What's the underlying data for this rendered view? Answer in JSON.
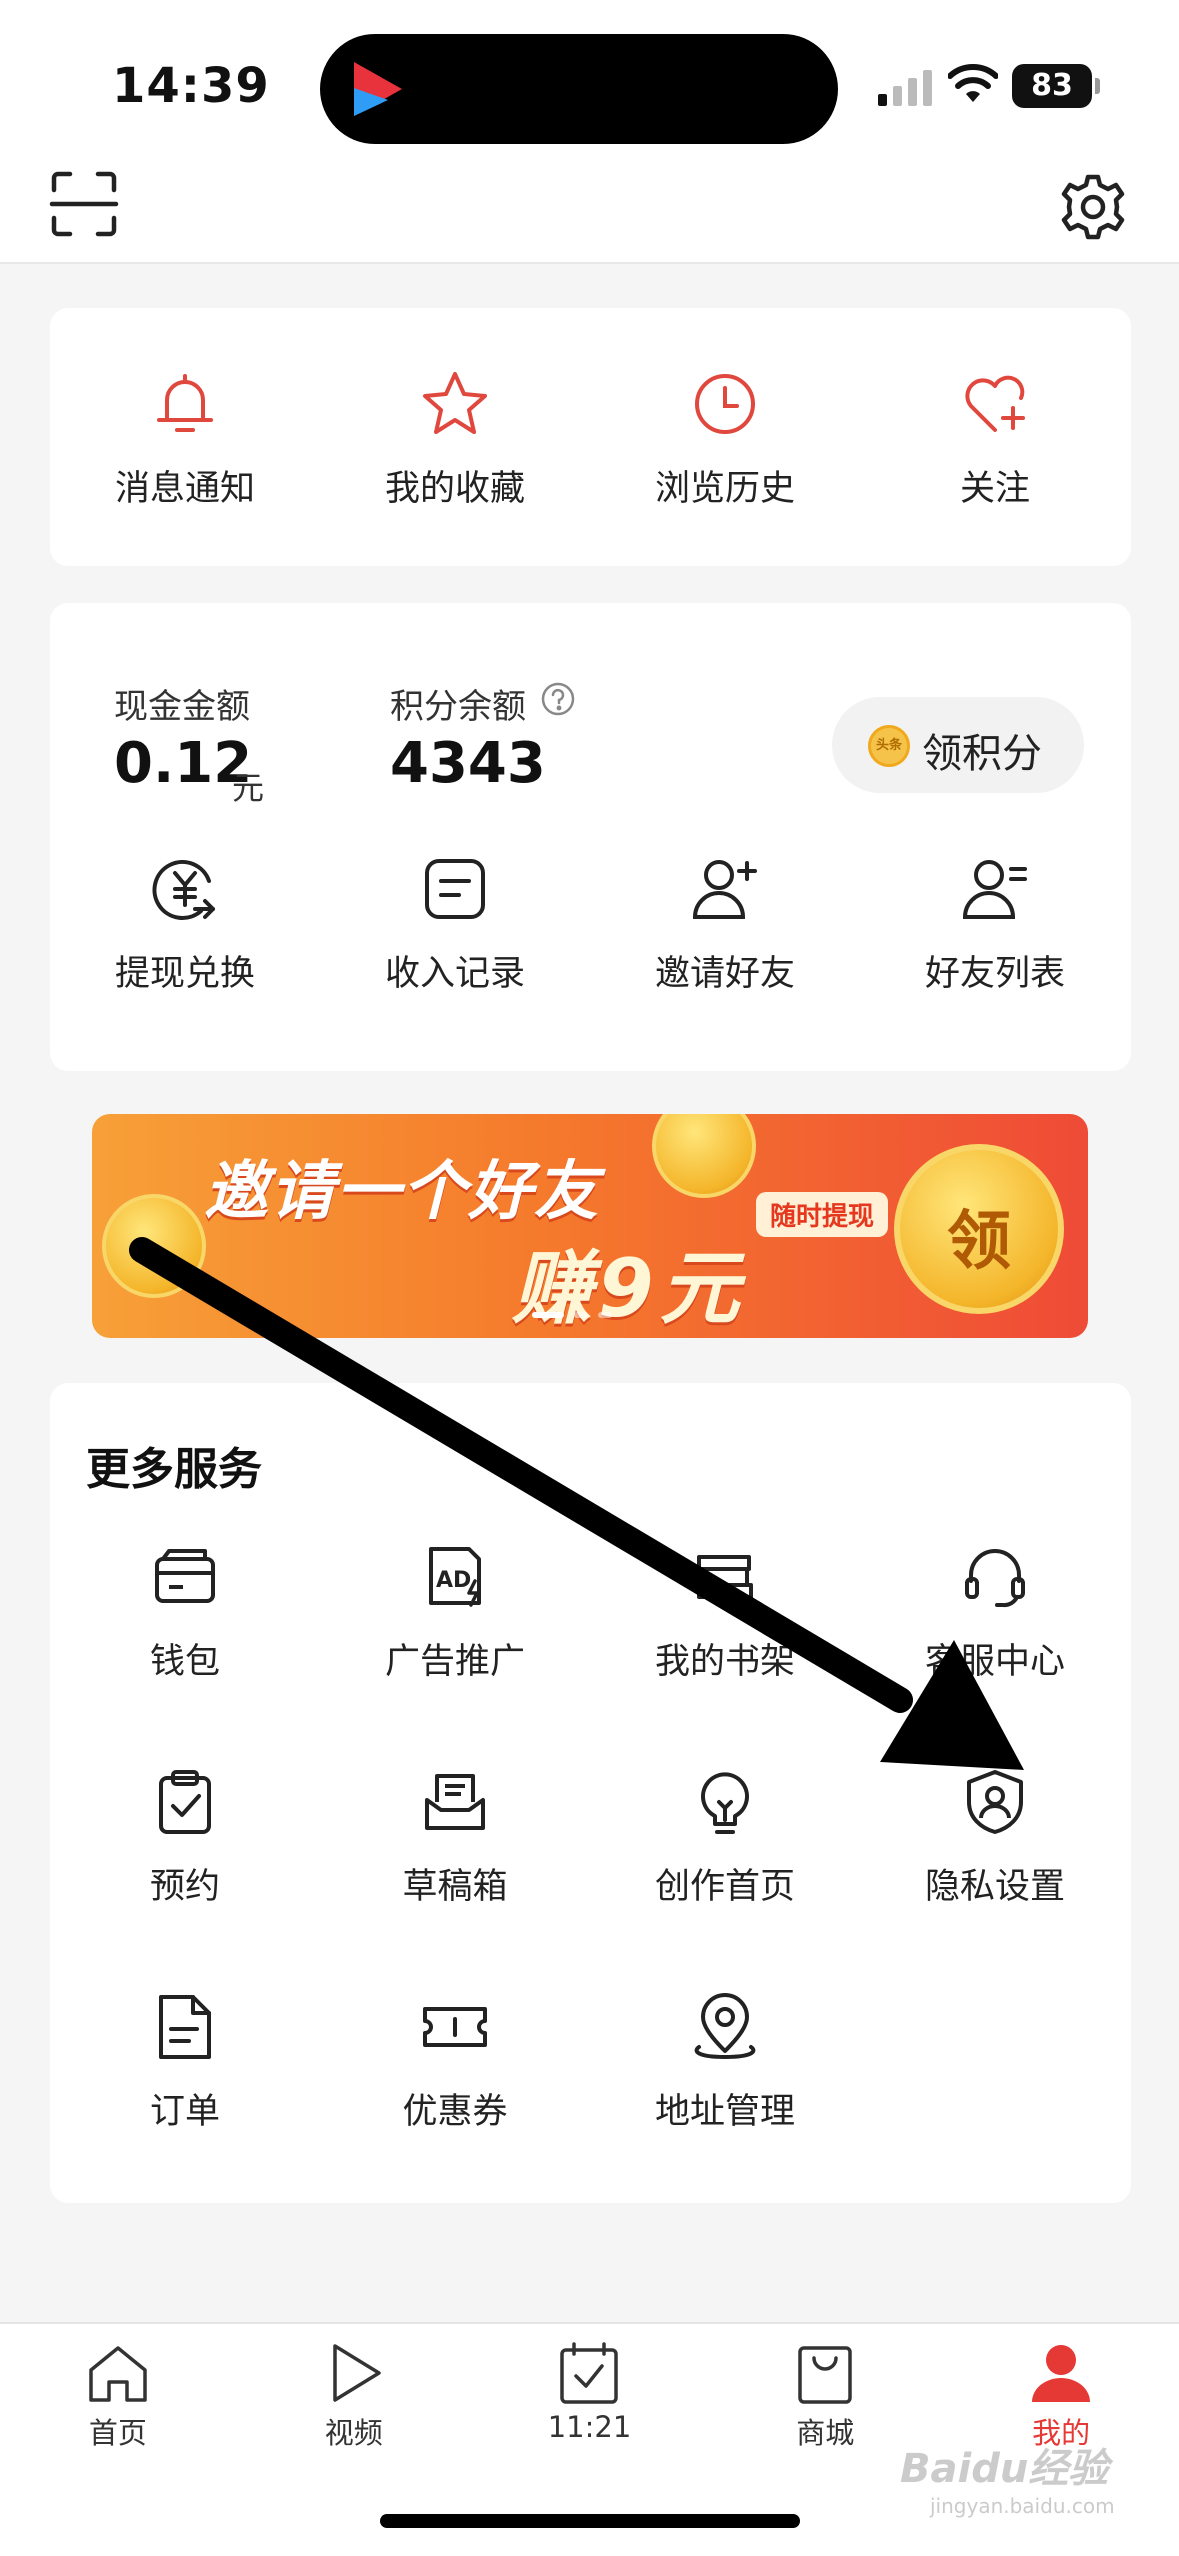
{
  "status_bar": {
    "time": "14:39",
    "battery": "83"
  },
  "top_bar": {
    "scan_icon": "scan-icon",
    "settings_icon": "gear-icon"
  },
  "quick_actions": [
    {
      "label": "消息通知",
      "icon": "bell-icon"
    },
    {
      "label": "我的收藏",
      "icon": "star-icon"
    },
    {
      "label": "浏览历史",
      "icon": "clock-icon"
    },
    {
      "label": "关注",
      "icon": "heart-plus-icon"
    }
  ],
  "wallet": {
    "cash_label": "现金金额",
    "cash_value": "0.12",
    "cash_unit": "元",
    "points_label": "积分余额",
    "points_value": "4343",
    "claim_button": "领积分",
    "coin_text": "头条",
    "actions": [
      {
        "label": "提现兑换",
        "icon": "yuan-exchange-icon"
      },
      {
        "label": "收入记录",
        "icon": "record-icon"
      },
      {
        "label": "邀请好友",
        "icon": "add-user-icon"
      },
      {
        "label": "好友列表",
        "icon": "user-list-icon"
      }
    ]
  },
  "banner": {
    "title": "邀请一个好友",
    "subtitle": "赚9元",
    "tag": "随时提现",
    "button": "领",
    "slide_count": 3,
    "active_slide": 1
  },
  "services": {
    "title": "更多服务",
    "items": [
      {
        "label": "钱包",
        "icon": "wallet-icon"
      },
      {
        "label": "广告推广",
        "icon": "ad-icon"
      },
      {
        "label": "我的书架",
        "icon": "bookshelf-icon"
      },
      {
        "label": "客服中心",
        "icon": "headset-icon"
      },
      {
        "label": "预约",
        "icon": "clipboard-check-icon"
      },
      {
        "label": "草稿箱",
        "icon": "draft-box-icon"
      },
      {
        "label": "创作首页",
        "icon": "lightbulb-icon"
      },
      {
        "label": "隐私设置",
        "icon": "shield-user-icon"
      },
      {
        "label": "订单",
        "icon": "order-doc-icon"
      },
      {
        "label": "优惠券",
        "icon": "coupon-icon"
      },
      {
        "label": "地址管理",
        "icon": "location-pin-icon"
      }
    ]
  },
  "tab_bar": {
    "tabs": [
      {
        "label": "首页",
        "icon": "home-icon",
        "active": false
      },
      {
        "label": "视频",
        "icon": "play-icon",
        "active": false
      },
      {
        "label": "11:21",
        "icon": "calendar-check-icon",
        "active": false
      },
      {
        "label": "商城",
        "icon": "shopping-bag-icon",
        "active": false
      },
      {
        "label": "我的",
        "icon": "user-icon",
        "active": true
      }
    ]
  },
  "watermark": {
    "brand": "Baidu经验",
    "url": "jingyan.baidu.com"
  },
  "colors": {
    "accent_red": "#e53935",
    "icon_gray": "#333333",
    "banner_start": "#f7a038",
    "banner_end": "#ef4b37"
  }
}
